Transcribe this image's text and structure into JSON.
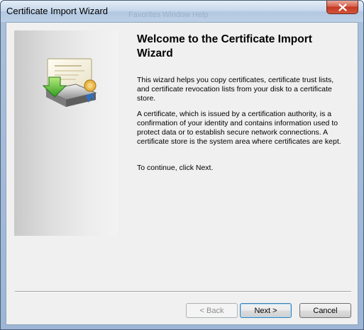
{
  "window": {
    "title": "Certificate Import Wizard",
    "ghost_menu": [
      "Favorites",
      "Window",
      "Help"
    ]
  },
  "wizard": {
    "heading": "Welcome to the Certificate Import Wizard",
    "paragraphs": [
      "This wizard helps you copy certificates, certificate trust lists, and certificate revocation lists from your disk to a certificate store.",
      "A certificate, which is issued by a certification authority, is a confirmation of your identity and contains information used to protect data or to establish secure network connections. A certificate store is the system area where certificates are kept.",
      "To continue, click Next."
    ]
  },
  "buttons": {
    "back": "< Back",
    "next": "Next >",
    "cancel": "Cancel"
  },
  "colors": {
    "close_button": "#c43a24",
    "client_bg": "#f0f0f0",
    "default_button_border": "#3c7fb1"
  }
}
